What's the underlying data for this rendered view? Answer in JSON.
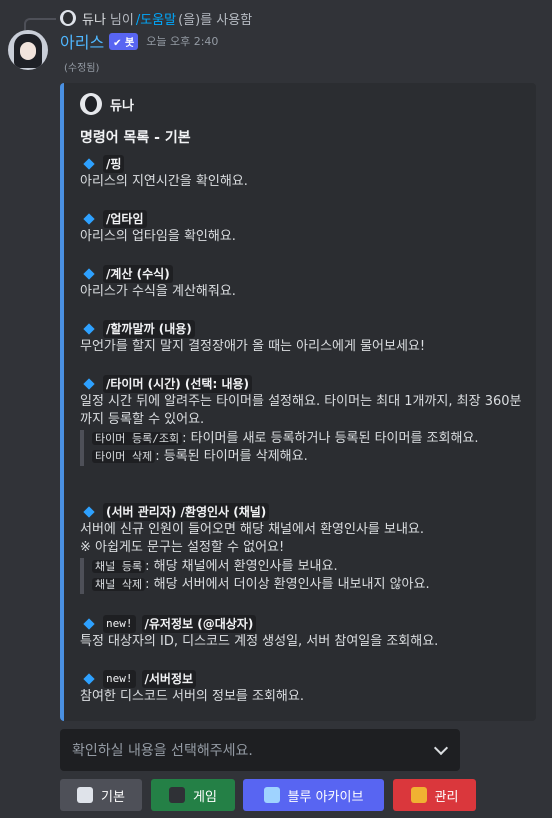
{
  "reply": {
    "username": "듀나",
    "middle": "님이",
    "command": "/도움말",
    "suffix": "(을)를 사용함"
  },
  "message": {
    "author": "아리스",
    "badge": "✔ 봇",
    "timestamp": "오늘 오후 2:40",
    "edited": "(수정됨)"
  },
  "embed": {
    "author": "듀나",
    "title": "명령어 목록 - 기본",
    "accent_color": "#4a90e2",
    "sections": [
      {
        "head": "/핑",
        "desc": "아리스의 지연시간을 확인해요."
      },
      {
        "head": "/업타임",
        "desc": "아리스의 업타임을 확인해요."
      },
      {
        "head": "/계산 (수식)",
        "desc": "아리스가 수식을 계산해줘요."
      },
      {
        "head": "/할까말까 (내용)",
        "desc": "무언가를 할지 말지 결정장애가 올 때는 아리스에게 물어보세요!"
      },
      {
        "head": "/타이머 (시간) (선택: 내용)",
        "desc": "일정 시간 뒤에 알려주는 타이머를 설정해요. 타이머는 최대 1개까지, 최장 360분까지 등록할 수 있어요.",
        "quotes": [
          {
            "code": "타이머 등록/조회",
            "text": ": 타이머를 새로 등록하거나 등록된 타이머를 조회해요."
          },
          {
            "code": "타이머 삭제",
            "text": ": 등록된 타이머를 삭제해요."
          }
        ]
      },
      {
        "head": "(서버 관리자) /환영인사 (채널)",
        "desc": "서버에 신규 인원이 들어오면 해당 채널에서 환영인사를 보내요.",
        "desc2": "※ 아쉽게도 문구는 설정할 수 없어요!",
        "quotes": [
          {
            "code": "채널 등록",
            "text": ": 해당 채널에서 환영인사를 보내요."
          },
          {
            "code": "채널 삭제",
            "text": ": 해당 서버에서 더이상 환영인사를 내보내지 않아요."
          }
        ]
      },
      {
        "badge": "new!",
        "head": "/유저정보 (@대상자)",
        "desc": "특정 대상자의 ID, 디스코드 계정 생성일, 서버 참여일을 조회해요."
      },
      {
        "badge": "new!",
        "head": "/서버정보",
        "desc": "참여한 디스코드 서버의 정보를 조회해요."
      }
    ]
  },
  "select": {
    "placeholder": "확인하실 내용을 선택해주세요.",
    "icon": "chevron-down-icon"
  },
  "buttons": [
    {
      "label": "기본",
      "icon": "aris-emoji-icon",
      "color": "#4e5058"
    },
    {
      "label": "게임",
      "icon": "gamepad-emoji-icon",
      "color": "#248046"
    },
    {
      "label": "블루 아카이브",
      "icon": "blue-archive-emoji-icon",
      "color": "#5865f2"
    },
    {
      "label": "관리",
      "icon": "tools-emoji-icon",
      "color": "#da373c"
    }
  ]
}
